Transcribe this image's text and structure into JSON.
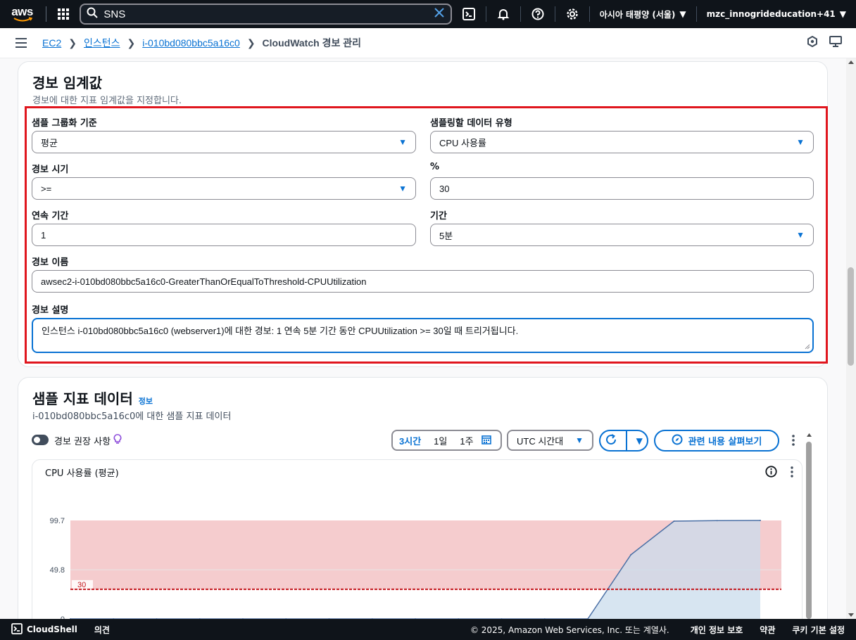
{
  "topnav": {
    "logo": "aws",
    "search_value": "SNS",
    "region": "아시아 태평양 (서울)",
    "account": "mzc_innogrideducation+41"
  },
  "breadcrumb": {
    "items": [
      "EC2",
      "인스턴스",
      "i-010bd080bbc5a16c0"
    ],
    "current": "CloudWatch 경보 관리"
  },
  "threshold": {
    "title": "경보 임계값",
    "subtitle": "경보에 대한 지표 임계값을 지정합니다.",
    "group_by_label": "샘플 그룹화 기준",
    "group_by_value": "평균",
    "data_type_label": "샘플링할 데이터 유형",
    "data_type_value": "CPU 사용률",
    "when_label": "경보 시기",
    "when_value": ">=",
    "percent_label": "%",
    "percent_value": "30",
    "consecutive_label": "연속 기간",
    "consecutive_value": "1",
    "period_label": "기간",
    "period_value": "5분",
    "name_label": "경보 이름",
    "name_value": "awsec2-i-010bd080bbc5a16c0-GreaterThanOrEqualToThreshold-CPUUtilization",
    "desc_label": "경보 설명",
    "desc_value": "인스턴스 i-010bd080bbc5a16c0 (webserver1)에 대한 경보: 1 연속 5분 기간 동안 CPUUtilization >= 30일 때 트리거됩니다."
  },
  "sample": {
    "title": "샘플 지표 데이터",
    "info": "정보",
    "subtitle": "i-010bd080bbc5a16c0에 대한 샘플 지표 데이터",
    "toggle_label": "경보 권장 사항",
    "range_3h": "3시간",
    "range_1d": "1일",
    "range_1w": "1주",
    "timezone": "UTC 시간대",
    "explore": "관련 내용 살펴보기",
    "chart_title": "CPU 사용률 (평균)"
  },
  "chart_data": {
    "type": "area",
    "title": "CPU 사용률 (평균)",
    "yticks": [
      "99.7",
      "49.8",
      "0"
    ],
    "ylim": [
      0,
      99.7
    ],
    "threshold": 30,
    "threshold_label": "30",
    "series": [
      {
        "values": [
          0,
          0,
          0,
          0,
          0,
          0,
          0,
          0,
          0,
          0,
          0,
          0,
          0,
          65,
          99,
          99.5,
          99.7
        ]
      }
    ],
    "colors": {
      "alarm_region": "#f4c7c9",
      "line": "#4a6fa5",
      "fill": "#c9dcec",
      "threshold": "#c4161c"
    }
  },
  "footer": {
    "cloudshell": "CloudShell",
    "feedback": "의견",
    "copyright": "© 2025, Amazon Web Services, Inc. 또는 계열사.",
    "privacy": "개인 정보 보호",
    "terms": "약관",
    "cookies": "쿠키 기본 설정"
  }
}
